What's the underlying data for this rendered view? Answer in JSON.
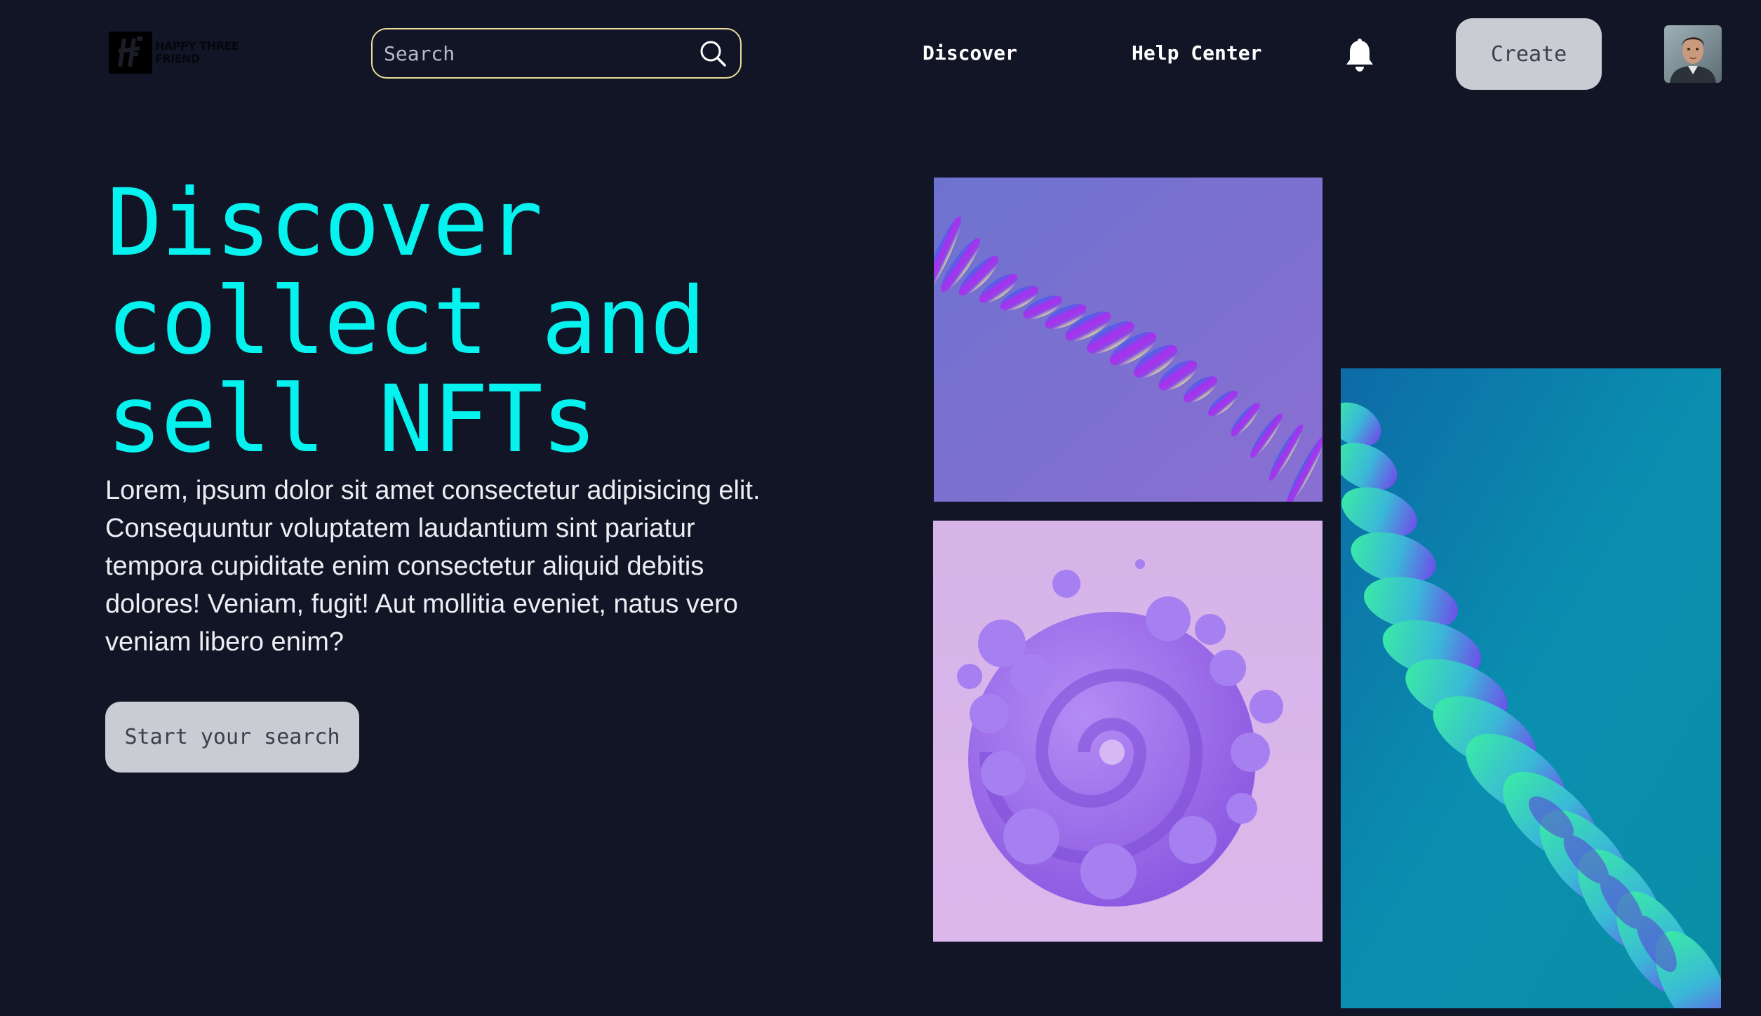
{
  "brand": {
    "logo_mark_text": "H",
    "name_line1": "HAPPY THREE",
    "name_line2": "FRIEND"
  },
  "search": {
    "placeholder": "Search",
    "icon": "search-icon"
  },
  "nav": {
    "items": [
      {
        "label": "Discover"
      },
      {
        "label": "Help Center"
      }
    ],
    "notification_icon": "bell-icon",
    "create_label": "Create",
    "avatar_icon": "user-avatar"
  },
  "hero": {
    "title_line1": "Discover",
    "title_line2": "collect and",
    "title_line3": "sell NFTs",
    "body": "Lorem, ipsum dolor sit amet consectetur adipisicing elit. Consequuntur voluptatem laudantium sint pariatur tempora cupiditate enim consectetur aliquid debitis dolores! Veniam, fugit! Aut mollitia eveniet, natus vero veniam libero enim?",
    "cta_label": "Start your search"
  },
  "gallery": {
    "items": [
      {
        "name": "purple-ribbon-artwork"
      },
      {
        "name": "lavender-swirl-artwork"
      },
      {
        "name": "teal-wave-artwork"
      }
    ]
  },
  "colors": {
    "background": "#111526",
    "accent": "#06f2ef",
    "button": "#c9ccd3",
    "search_border": "#e8dd9a"
  }
}
